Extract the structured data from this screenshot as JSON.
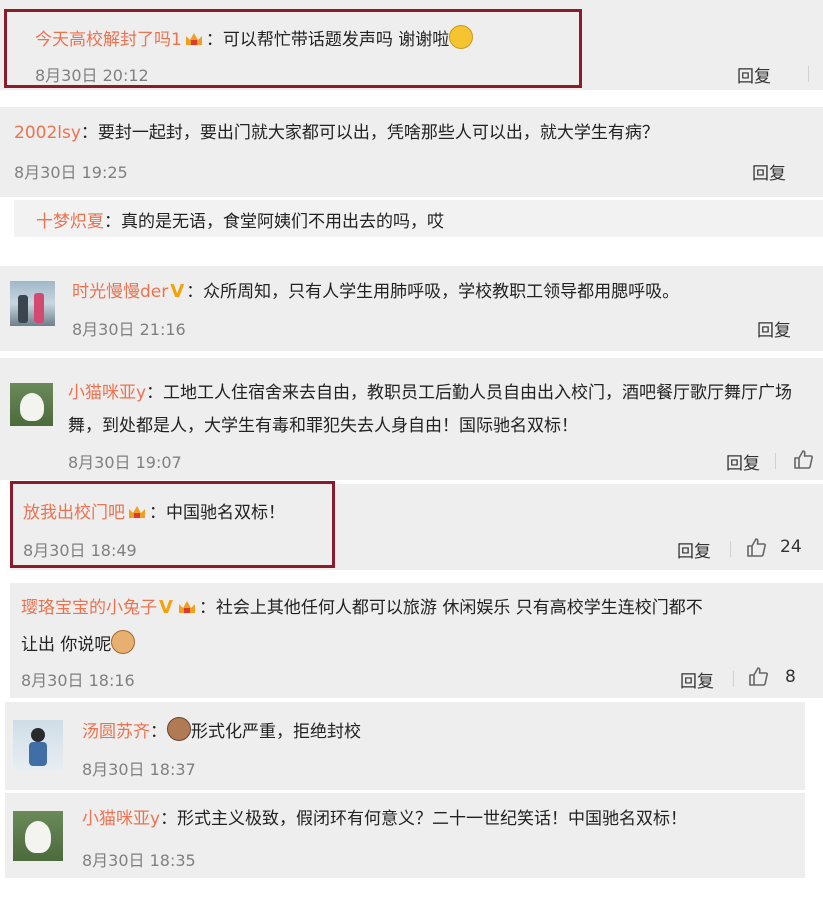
{
  "comments": [
    {
      "user": "今天高校解封了吗1",
      "text": "：可以帮忙带话题发声吗  谢谢啦",
      "time": "8月30日 20:12",
      "reply": "回复"
    },
    {
      "user": "2002lsy",
      "text": "：要封一起封，要出门就大家都可以出，凭啥那些人可以出，就大学生有病？",
      "time": "8月30日 19:25",
      "reply": "回复"
    },
    {
      "user": "十梦炽夏",
      "text": "：真的是无语，食堂阿姨们不用出去的吗，哎"
    },
    {
      "user": "时光慢慢der",
      "text": "：众所周知，只有人学生用肺呼吸，学校教职工领导都用腮呼吸。",
      "time": "8月30日 21:16",
      "reply": "回复"
    },
    {
      "user": "小猫咪亚y",
      "text_line1": "：工地工人住宿舍来去自由，教职员工后勤人员自由出入校门，酒吧餐厅歌厅舞厅广场",
      "text_line2": "舞，到处都是人，大学生有毒和罪犯失去人身自由！国际驰名双标！",
      "time": "8月30日 19:07",
      "reply": "回复"
    },
    {
      "user": "放我出校门吧",
      "text": "：中国驰名双标！",
      "time": "8月30日 18:49",
      "reply": "回复",
      "likes": "24"
    },
    {
      "user": "璎珞宝宝的小兔子",
      "text_line1": "：社会上其他任何人都可以旅游 休闲娱乐 只有高校学生连校门都不",
      "text_line2": "让出 你说呢",
      "time": "8月30日 18:16",
      "reply": "回复",
      "likes": "8"
    },
    {
      "user": "汤圆苏齐",
      "text": "形式化严重，拒绝封校",
      "text_prefix": "：",
      "time": "8月30日 18:37"
    },
    {
      "user": "小猫咪亚y",
      "text": "：形式主义极致，假闭环有何意义？二十一世纪笑话！中国驰名双标！",
      "time": "8月30日 18:35"
    }
  ],
  "colors": {
    "username": "#eb7350",
    "highlight_box": "#8b1c2b",
    "vip_badge": "#f2a20c"
  },
  "icons": [
    "crown-icon",
    "crying-emoji-icon",
    "verified-v-icon",
    "thumbs-up-icon",
    "doge-emoji-icon",
    "cat-emoji-icon"
  ]
}
